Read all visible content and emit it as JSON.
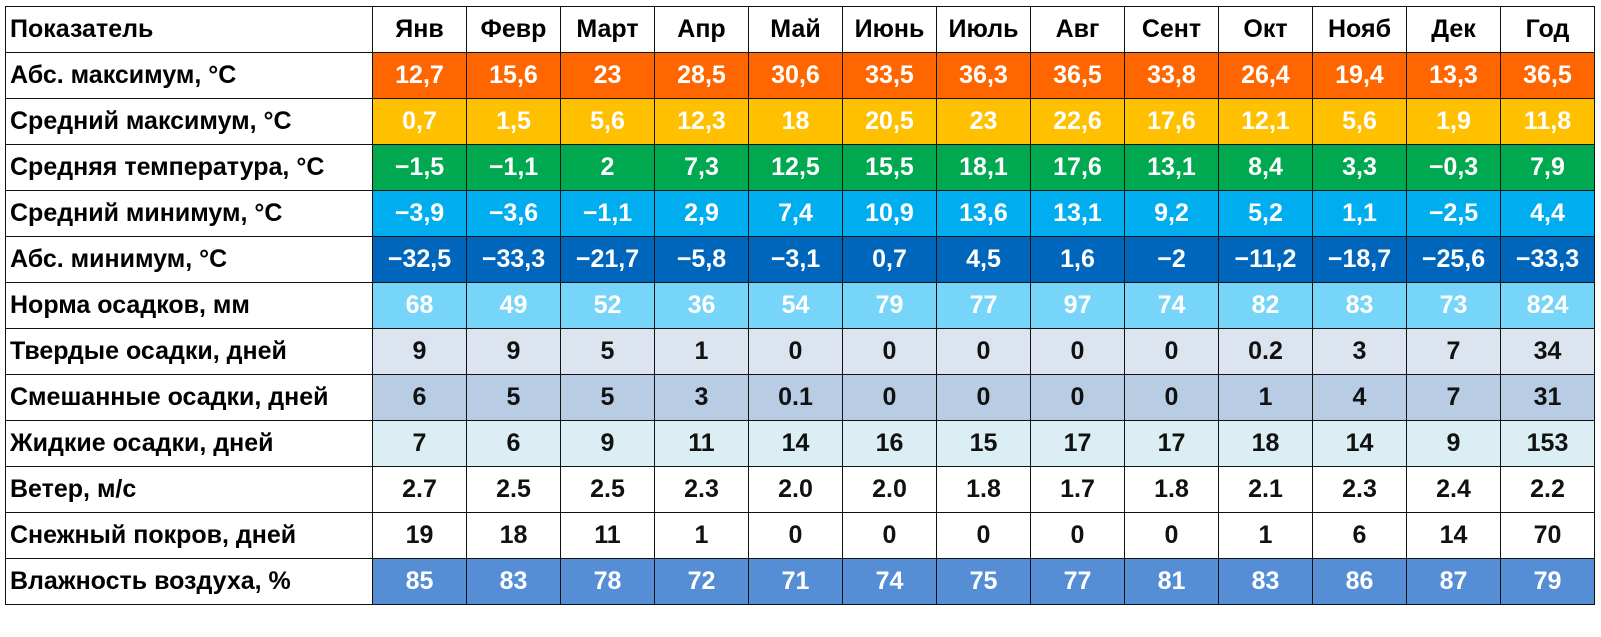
{
  "table": {
    "header": {
      "label": "Показатель",
      "months": [
        "Янв",
        "Февр",
        "Март",
        "Апр",
        "Май",
        "Июнь",
        "Июль",
        "Авг",
        "Сент",
        "Окт",
        "Нояб",
        "Дек",
        "Год"
      ]
    },
    "rows": [
      {
        "label": "Абс. максимум, °C",
        "color": "#FF6600",
        "text_color": "#ffffff",
        "values": [
          "12,7",
          "15,6",
          "23",
          "28,5",
          "30,6",
          "33,5",
          "36,3",
          "36,5",
          "33,8",
          "26,4",
          "19,4",
          "13,3",
          "36,5"
        ]
      },
      {
        "label": "Средний максимум, °C",
        "color": "#FFC000",
        "text_color": "#ffffff",
        "values": [
          "0,7",
          "1,5",
          "5,6",
          "12,3",
          "18",
          "20,5",
          "23",
          "22,6",
          "17,6",
          "12,1",
          "5,6",
          "1,9",
          "11,8"
        ]
      },
      {
        "label": "Средняя температура, °C",
        "color": "#00A84F",
        "text_color": "#ffffff",
        "values": [
          "−1,5",
          "−1,1",
          "2",
          "7,3",
          "12,5",
          "15,5",
          "18,1",
          "17,6",
          "13,1",
          "8,4",
          "3,3",
          "−0,3",
          "7,9"
        ]
      },
      {
        "label": "Средний минимум, °C",
        "color": "#00AEEF",
        "text_color": "#ffffff",
        "values": [
          "−3,9",
          "−3,6",
          "−1,1",
          "2,9",
          "7,4",
          "10,9",
          "13,6",
          "13,1",
          "9,2",
          "5,2",
          "1,1",
          "−2,5",
          "4,4"
        ]
      },
      {
        "label": "Абс. минимум, °C",
        "color": "#0066BB",
        "text_color": "#ffffff",
        "values": [
          "−32,5",
          "−33,3",
          "−21,7",
          "−5,8",
          "−3,1",
          "0,7",
          "4,5",
          "1,6",
          "−2",
          "−11,2",
          "−18,7",
          "−25,6",
          "−33,3"
        ]
      },
      {
        "label": "Норма осадков, мм",
        "color": "#76D5F8",
        "text_color": "#ffffff",
        "values": [
          "68",
          "49",
          "52",
          "36",
          "54",
          "79",
          "77",
          "97",
          "74",
          "82",
          "83",
          "73",
          "824"
        ]
      },
      {
        "label": "Твердые осадки, дней",
        "color": "#DCE4F0",
        "text_color": "#111111",
        "values": [
          "9",
          "9",
          "5",
          "1",
          "0",
          "0",
          "0",
          "0",
          "0",
          "0.2",
          "3",
          "7",
          "34"
        ]
      },
      {
        "label": "Смешанные осадки, дней",
        "color": "#B8CCE4",
        "text_color": "#111111",
        "values": [
          "6",
          "5",
          "5",
          "3",
          "0.1",
          "0",
          "0",
          "0",
          "0",
          "1",
          "4",
          "7",
          "31"
        ]
      },
      {
        "label": "Жидкие осадки, дней",
        "color": "#DAEEF3",
        "text_color": "#111111",
        "values": [
          "7",
          "6",
          "9",
          "11",
          "14",
          "16",
          "15",
          "17",
          "17",
          "18",
          "14",
          "9",
          "153"
        ]
      },
      {
        "label": "Ветер, м/с",
        "color": "#FFFFFF",
        "text_color": "#111111",
        "values": [
          "2.7",
          "2.5",
          "2.5",
          "2.3",
          "2.0",
          "2.0",
          "1.8",
          "1.7",
          "1.8",
          "2.1",
          "2.3",
          "2.4",
          "2.2"
        ]
      },
      {
        "label": "Снежный покров, дней",
        "color": "#FFFFFF",
        "text_color": "#111111",
        "values": [
          "19",
          "18",
          "11",
          "1",
          "0",
          "0",
          "0",
          "0",
          "0",
          "1",
          "6",
          "14",
          "70"
        ]
      },
      {
        "label": "Влажность воздуха, %",
        "color": "#558ED5",
        "text_color": "#ffffff",
        "values": [
          "85",
          "83",
          "78",
          "72",
          "71",
          "74",
          "75",
          "77",
          "81",
          "83",
          "86",
          "87",
          "79"
        ]
      }
    ]
  }
}
